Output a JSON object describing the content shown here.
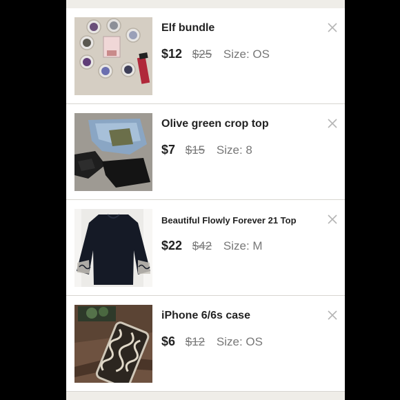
{
  "listings": [
    {
      "title": "Elf bundle",
      "price": "$12",
      "original_price": "$25",
      "size_label": "Size:",
      "size": "OS",
      "image": "makeup-eyeshadow-bundle"
    },
    {
      "title": "Olive green crop top",
      "price": "$7",
      "original_price": "$15",
      "size_label": "Size:",
      "size": "8",
      "image": "clothing-pile"
    },
    {
      "title": "Beautiful Flowly Forever 21 Top",
      "price": "$22",
      "original_price": "$42",
      "size_label": "Size:",
      "size": "M",
      "image": "black-embroidered-top"
    },
    {
      "title": "iPhone 6/6s case",
      "price": "$6",
      "original_price": "$12",
      "size_label": "Size:",
      "size": "OS",
      "image": "filigree-phone-case"
    }
  ],
  "icons": {
    "remove": "close-icon"
  },
  "colors": {
    "background": "#000000",
    "card": "#ffffff",
    "text": "#222222",
    "muted": "#777777"
  }
}
